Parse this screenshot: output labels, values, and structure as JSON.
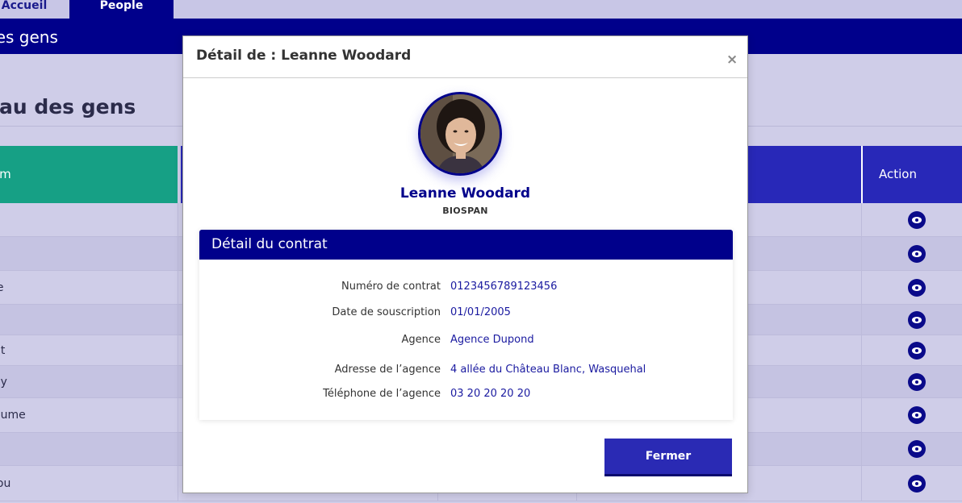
{
  "nav": {
    "tab_home": "Accueil",
    "tab_people": "People"
  },
  "banner": {
    "title": "des gens"
  },
  "section": {
    "heading": "eau des gens"
  },
  "table": {
    "col_name": "om",
    "col_action": "Action",
    "rows": [
      "n",
      "e",
      "ie",
      "n",
      "nt",
      "ey",
      "aume",
      "e",
      "lou"
    ]
  },
  "modal": {
    "title": "Détail de : Leanne Woodard",
    "close_symbol": "×",
    "person_name": "Leanne Woodard",
    "company": "BIOSPAN",
    "contract": {
      "header": "Détail du contrat",
      "fields": [
        {
          "label": "Numéro de contrat",
          "value": "0123456789123456"
        },
        {
          "label": "Date de  souscription",
          "value": "01/01/2005"
        },
        {
          "label": "Agence",
          "value": "Agence Dupond"
        },
        {
          "label": "Adresse de l’agence",
          "value": "4 allée du Château Blanc, Wasquehal"
        },
        {
          "label": "Téléphone de l’agence",
          "value": "03 20 20 20 20"
        }
      ]
    },
    "close_button": "Fermer"
  },
  "icons": {
    "row_action": "eye-icon",
    "modal_close": "close-icon"
  },
  "colors": {
    "primary": "#00008b",
    "accent": "#16a085",
    "button": "#2a2ab4",
    "link": "#1a1aa0"
  }
}
